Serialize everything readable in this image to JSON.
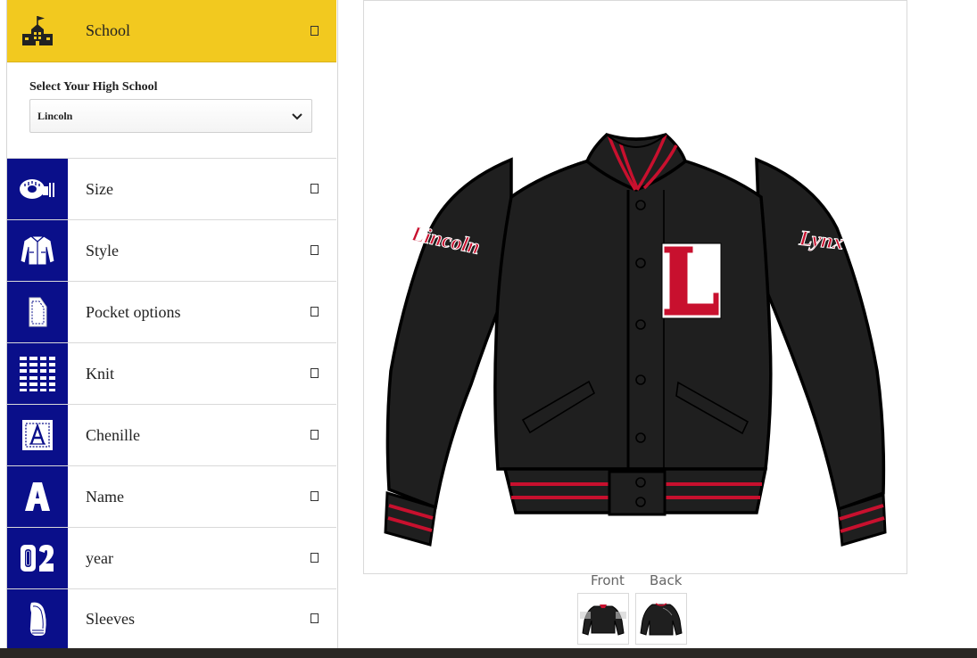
{
  "school": {
    "label": "School",
    "select_label": "Select Your High School",
    "selected_value": "Lincoln",
    "icon": "school-building-icon"
  },
  "menu": [
    {
      "label": "Size",
      "icon": "tape-measure-icon"
    },
    {
      "label": "Style",
      "icon": "jacket-style-icon"
    },
    {
      "label": "Pocket options",
      "icon": "pocket-icon"
    },
    {
      "label": "Knit",
      "icon": "knit-stripes-icon"
    },
    {
      "label": "Chenille",
      "icon": "chenille-letter-icon"
    },
    {
      "label": "Name",
      "icon": "letter-a-icon"
    },
    {
      "label": "year",
      "icon": "year-number-icon"
    },
    {
      "label": "Sleeves",
      "icon": "sleeve-icon"
    }
  ],
  "preview": {
    "chest_letter": "L",
    "left_sleeve_text": "Lincoln",
    "right_sleeve_text": "Lynx",
    "colors": {
      "body": "#1f1f1f",
      "accent": "#c8102e",
      "sidebar_icon_bg": "#0a0f8a",
      "school_bar": "#f2c91f"
    }
  },
  "thumbnails": {
    "front_label": "Front",
    "back_label": "Back"
  }
}
